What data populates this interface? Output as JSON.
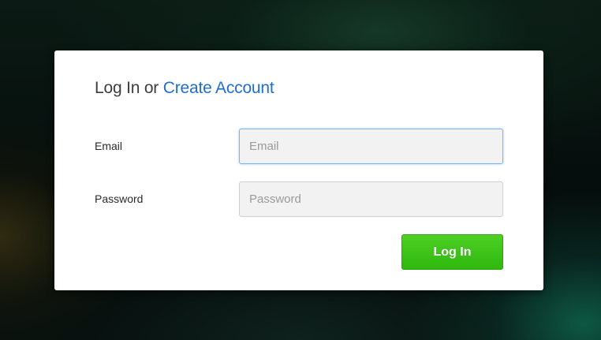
{
  "login_card": {
    "heading_prefix": "Log In or ",
    "create_account_link": "Create Account",
    "email_label": "Email",
    "email_placeholder": "Email",
    "email_value": "",
    "password_label": "Password",
    "password_placeholder": "Password",
    "password_value": "",
    "login_button_label": "Log In"
  },
  "colors": {
    "link": "#1f6fcf",
    "button_green": "#2fb80f",
    "focus_border": "#7bb4ea"
  }
}
